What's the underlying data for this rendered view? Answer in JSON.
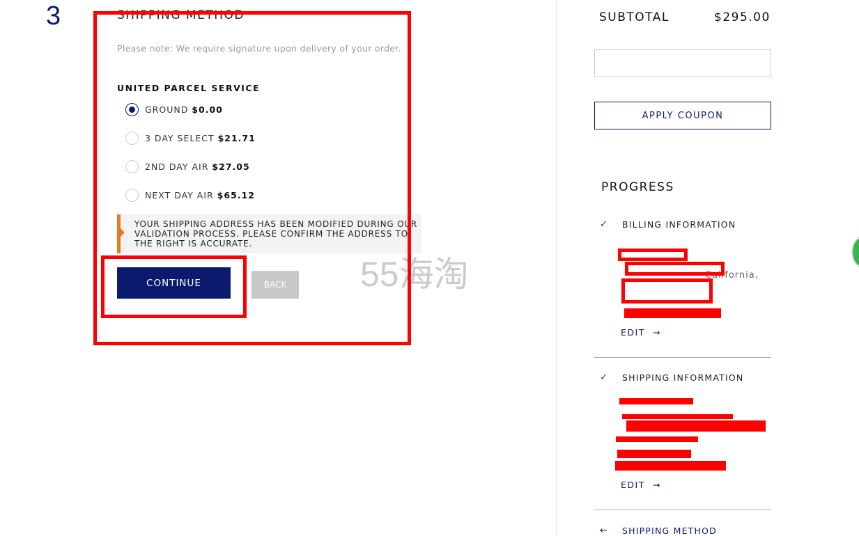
{
  "step_number": "3",
  "shipping": {
    "title": "SHIPPING METHOD",
    "note": "Please note: We require signature upon delivery of your order.",
    "carrier": "UNITED PARCEL SERVICE",
    "options": [
      {
        "label": "GROUND",
        "price": "$0.00",
        "selected": true
      },
      {
        "label": "3 DAY SELECT",
        "price": "$21.71",
        "selected": false
      },
      {
        "label": "2ND DAY AIR",
        "price": "$27.05",
        "selected": false
      },
      {
        "label": "NEXT DAY AIR",
        "price": "$65.12",
        "selected": false
      }
    ],
    "warning": "YOUR SHIPPING ADDRESS HAS BEEN MODIFIED DURING OUR VALIDATION PROCESS. PLEASE CONFIRM THE ADDRESS TO THE RIGHT IS ACCURATE.",
    "continue_label": "CONTINUE",
    "back_label": "BACK"
  },
  "watermark": "55海淘",
  "summary": {
    "subtotal_label": "SUBTOTAL",
    "subtotal_value": "$295.00",
    "coupon_placeholder": "",
    "apply_label": "APPLY COUPON"
  },
  "progress": {
    "title": "PROGRESS",
    "billing_title": "BILLING INFORMATION",
    "billing_visible": "California,",
    "shipping_title": "SHIPPING INFORMATION",
    "edit_label": "EDIT",
    "method_title": "SHIPPING METHOD"
  },
  "colors": {
    "accent": "#0b1a6e",
    "warning": "#e87a1e",
    "annotation": "#ff0000"
  }
}
